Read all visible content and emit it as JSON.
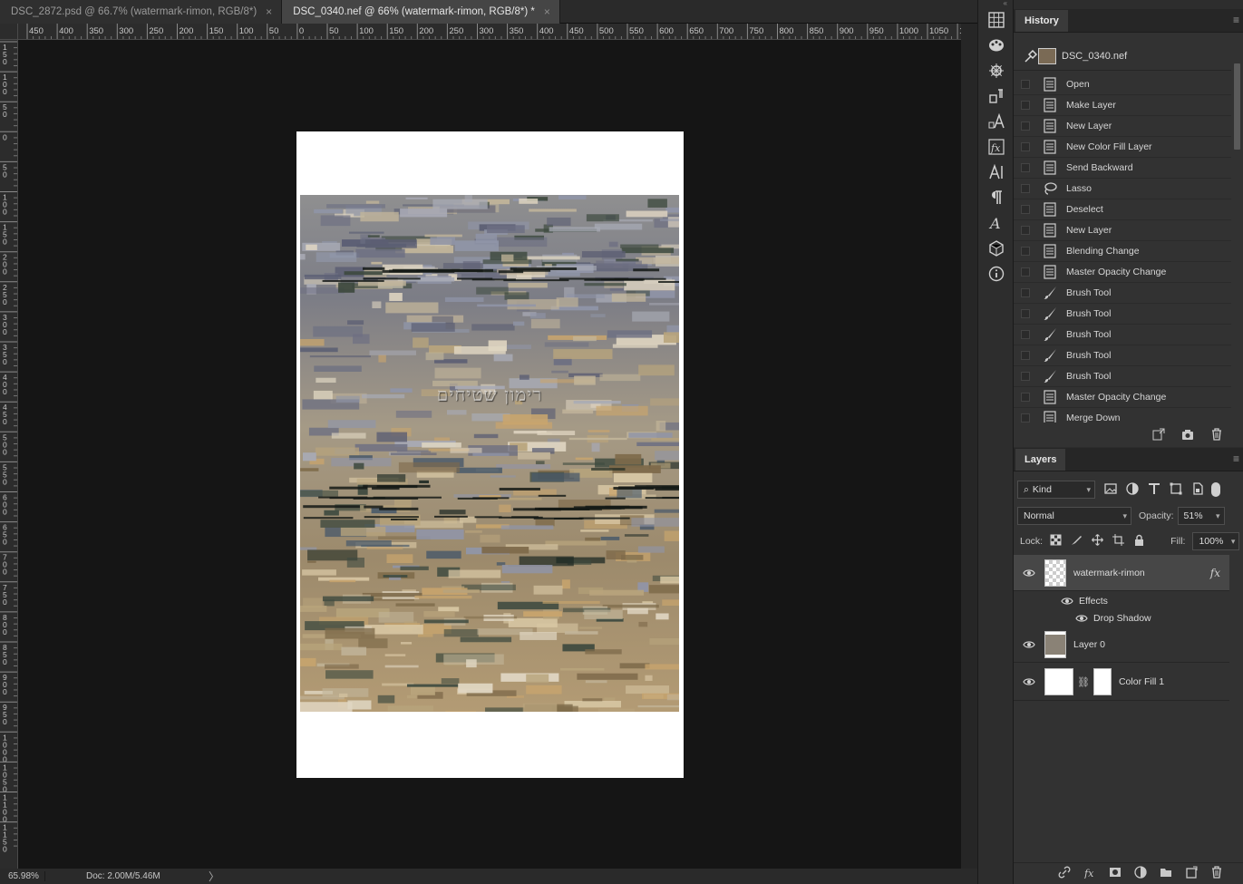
{
  "tabs": [
    {
      "label": "DSC_2872.psd @ 66.7% (watermark-rimon, RGB/8*)",
      "close": "×"
    },
    {
      "label": "DSC_0340.nef @ 66% (watermark-rimon, RGB/8*) *",
      "close": "×"
    }
  ],
  "ruler_h_labels": [
    "450",
    "400",
    "350",
    "300",
    "250",
    "200",
    "150",
    "100",
    "50",
    "0",
    "50",
    "100",
    "150",
    "200",
    "250",
    "300",
    "350",
    "400",
    "450",
    "500",
    "550",
    "600",
    "650",
    "700",
    "750",
    "800",
    "850",
    "900",
    "950",
    "1000",
    "1050",
    "1"
  ],
  "ruler_v_labels": [
    "150",
    "100",
    "50",
    "0",
    "50",
    "100",
    "150",
    "200",
    "250",
    "300",
    "350",
    "400",
    "450",
    "500",
    "550",
    "600",
    "650",
    "700",
    "750",
    "800",
    "850",
    "900",
    "950",
    "1000",
    "1050",
    "1100",
    "1150"
  ],
  "canvas": {
    "watermark_text": "רימון שטיחים"
  },
  "status": {
    "zoom": "65.98%",
    "doc": "Doc: 2.00M/5.46M",
    "arrow": "〉"
  },
  "history": {
    "title": "History",
    "menu": "≡",
    "snapshot": "DSC_0340.nef",
    "items": [
      {
        "label": "Open",
        "icon": "document-icon"
      },
      {
        "label": "Make Layer",
        "icon": "document-icon"
      },
      {
        "label": "New Layer",
        "icon": "document-icon"
      },
      {
        "label": "New Color Fill Layer",
        "icon": "document-icon"
      },
      {
        "label": "Send Backward",
        "icon": "document-icon"
      },
      {
        "label": "Lasso",
        "icon": "lasso-icon"
      },
      {
        "label": "Deselect",
        "icon": "document-icon"
      },
      {
        "label": "New Layer",
        "icon": "document-icon"
      },
      {
        "label": "Blending Change",
        "icon": "document-icon"
      },
      {
        "label": "Master Opacity Change",
        "icon": "document-icon"
      },
      {
        "label": "Brush Tool",
        "icon": "brush-icon"
      },
      {
        "label": "Brush Tool",
        "icon": "brush-icon"
      },
      {
        "label": "Brush Tool",
        "icon": "brush-icon"
      },
      {
        "label": "Brush Tool",
        "icon": "brush-icon"
      },
      {
        "label": "Brush Tool",
        "icon": "brush-icon"
      },
      {
        "label": "Master Opacity Change",
        "icon": "document-icon"
      },
      {
        "label": "Merge Down",
        "icon": "document-icon"
      }
    ]
  },
  "layers": {
    "title": "Layers",
    "menu": "≡",
    "kind": "Kind",
    "blend_mode": "Normal",
    "opacity_label": "Opacity:",
    "opacity": "51%",
    "lock_label": "Lock:",
    "fill_label": "Fill:",
    "fill": "100%",
    "list": [
      {
        "name": "watermark-rimon",
        "fx": "fx",
        "selected": true
      },
      {
        "name": "Layer 0",
        "selected": false
      },
      {
        "name": "Color Fill 1",
        "selected": false
      }
    ],
    "effects_label": "Effects",
    "drop_shadow_label": "Drop Shadow"
  },
  "colors": {
    "canvas_bg": "#151515",
    "panel_bg": "#323232",
    "selected_layer": "#474747"
  }
}
